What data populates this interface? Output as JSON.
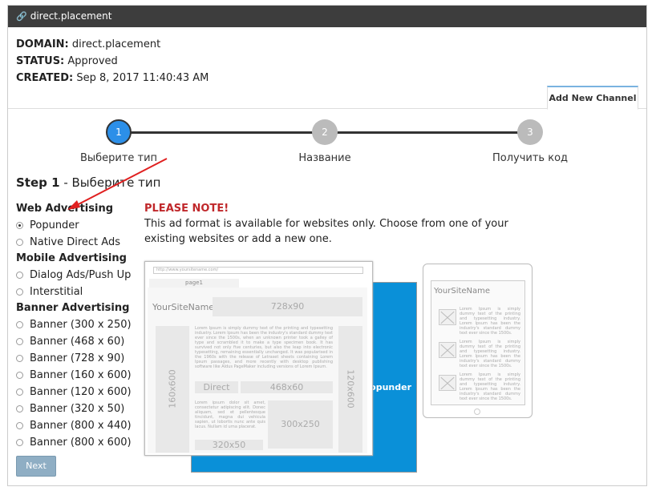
{
  "title": "direct.placement",
  "info": {
    "domain_label": "DOMAIN:",
    "domain": "direct.placement",
    "status_label": "STATUS:",
    "status": "Approved",
    "created_label": "CREATED:",
    "created": "Sep 8, 2017 11:40:43 AM"
  },
  "tab": "Add New Channel",
  "steps": [
    {
      "num": "1",
      "label": "Выберите тип"
    },
    {
      "num": "2",
      "label": "Название"
    },
    {
      "num": "3",
      "label": "Получить код"
    }
  ],
  "step_heading": {
    "num": "Step 1",
    "text": " - Выберите тип"
  },
  "groups": [
    {
      "label": "Web Advertising",
      "options": [
        "Popunder",
        "Native Direct Ads"
      ]
    },
    {
      "label": "Mobile Advertising",
      "options": [
        "Dialog Ads/Push Up",
        "Interstitial"
      ]
    },
    {
      "label": "Banner Advertising",
      "options": [
        "Banner (300 x 250)",
        "Banner (468 x 60)",
        "Banner (728 x 90)",
        "Banner (160 x 600)",
        "Banner (120 x 600)",
        "Banner (320 x 50)",
        "Banner (800 x 440)",
        "Banner (800 x 600)"
      ]
    }
  ],
  "selected": "Popunder",
  "next": "Next",
  "note": {
    "title": "PLEASE NOTE!",
    "text": "This ad format is available for websites only. Choose from one of your existing websites or add a new one."
  },
  "preview": {
    "url": "http://www.yoursitename.com/",
    "tab": "page1",
    "site": "YourSiteName",
    "b728": "728x90",
    "b160": "160x600",
    "b120": "120x600",
    "direct": "Direct",
    "b468": "468x60",
    "b300": "300x250",
    "b320": "320x50",
    "popunder": "Popunder",
    "lorem1": "Lorem Ipsum is simply dummy text of the printing and typesetting industry. Lorem Ipsum has been the industry's standard dummy text ever since the 1500s, when an unknown printer took a galley of type and scrambled it to make a type specimen book. It has survived not only five centuries, but also the leap into electronic typesetting, remaining essentially unchanged. It was popularised in the 1960s with the release of Letraset sheets containing Lorem Ipsum passages, and more recently with desktop publishing software like Aldus PageMaker including versions of Lorem Ipsum.",
    "lorem2": "Lorem ipsum dolor sit amet, consectetur adipiscing elit. Donec aliquam, sed et pellentesque tincidunt, magna dui vehicula sapien, ut lobortis nunc ante quis lacus. Nullam id urna placerat.",
    "mobile_site": "YourSiteName",
    "mobile_lorem": "Lorem Ipsum is simply dummy text of the printing and typesetting industry. Lorem Ipsum has been the industry's standard dummy text ever since the 1500s."
  }
}
